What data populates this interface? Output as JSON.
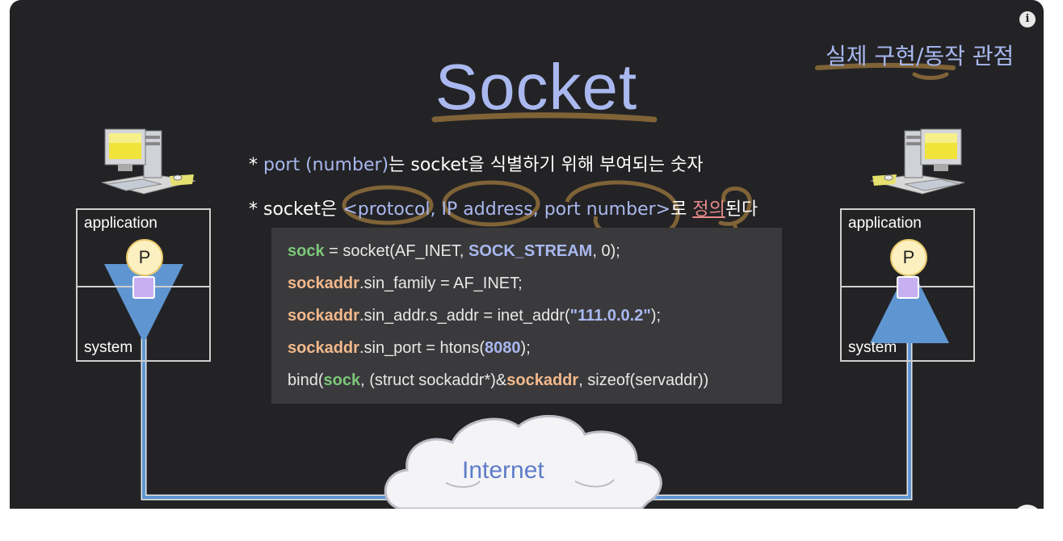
{
  "title": "Socket",
  "perspective_label": "실제 구현/동작 관점",
  "info_icon": "i",
  "bullets": {
    "b1_star": "* ",
    "b1_blue": "port (number)",
    "b1_rest": "는 socket을 식별하기 위해 부여되는 숫자",
    "b2_star": "* ",
    "b2_pre": "socket은 ",
    "b2_blue": "<protocol, IP address, port number>",
    "b2_mid": "로 ",
    "b2_pink": "정의",
    "b2_end": "된다"
  },
  "code": {
    "l1": {
      "a": "sock",
      "b": " = socket(AF_INET, ",
      "c": "SOCK_STREAM",
      "d": ", 0);"
    },
    "l2": {
      "a": "sockaddr",
      "b": ".sin_family = AF_INET;"
    },
    "l3": {
      "a": "sockaddr",
      "b": ".sin_addr.s_addr = inet_addr(",
      "c": "\"111.0.0.2\"",
      "d": ");"
    },
    "l4": {
      "a": "sockaddr",
      "b": ".sin_port = htons(",
      "c": "8080",
      "d": ");"
    },
    "l5": {
      "a": "bind(",
      "b": "sock",
      "c": ", (struct sockaddr*)&",
      "d": "sockaddr",
      "e": ", sizeof(servaddr))"
    }
  },
  "hosts": {
    "left": {
      "top_label": "application",
      "bottom_label": "system",
      "process": "P"
    },
    "right": {
      "top_label": "application",
      "bottom_label": "system",
      "process": "P"
    }
  },
  "internet_label": "Internet",
  "colors": {
    "background": "#232325",
    "title": "#aab8f0",
    "code_bg": "#3a3a3c",
    "keyword_green": "#7cc87a",
    "keyword_orange": "#f2b98c",
    "keyword_blue": "#a9b8ef",
    "annotation_brown": "#8a6a3a",
    "network_line": "#5f96d2"
  },
  "icons": [
    "desktop-computer-icon",
    "cloud-icon",
    "info-icon"
  ]
}
